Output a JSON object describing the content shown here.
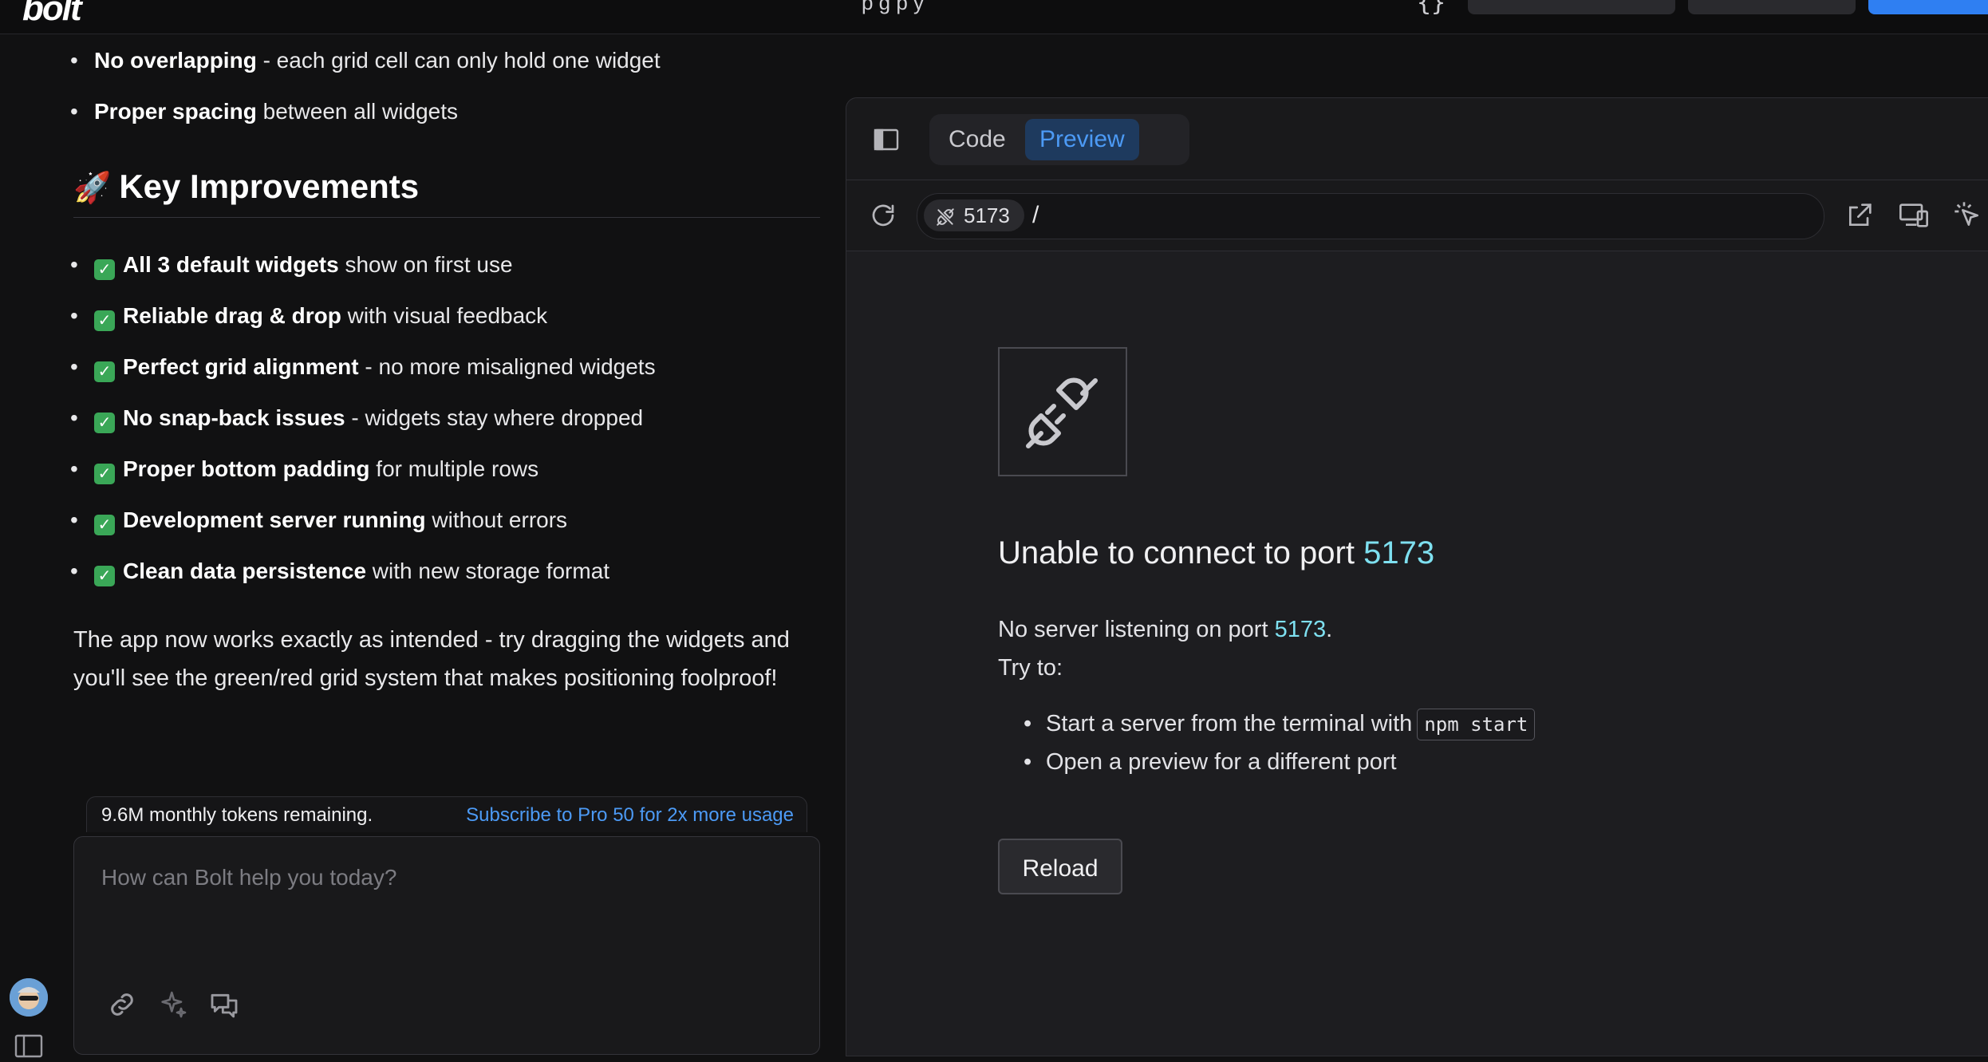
{
  "topbar": {
    "logo": "bolt",
    "title_fragment": "p  g      p   y",
    "braces": "{}"
  },
  "chat": {
    "intro_items": [
      {
        "bold": "No overlapping",
        "rest": " - each grid cell can only hold one widget"
      },
      {
        "bold": "Proper spacing",
        "rest": " between all widgets"
      }
    ],
    "heading_emoji": "🚀",
    "heading": "Key Improvements",
    "check_glyph": "✓",
    "improvements": [
      {
        "bold": "All 3 default widgets",
        "rest": " show on first use"
      },
      {
        "bold": "Reliable drag & drop",
        "rest": " with visual feedback"
      },
      {
        "bold": "Perfect grid alignment",
        "rest": " - no more misaligned widgets"
      },
      {
        "bold": "No snap-back issues",
        "rest": " - widgets stay where dropped"
      },
      {
        "bold": "Proper bottom padding",
        "rest": " for multiple rows"
      },
      {
        "bold": "Development server running",
        "rest": " without errors"
      },
      {
        "bold": "Clean data persistence",
        "rest": " with new storage format"
      }
    ],
    "summary": "The app now works exactly as intended - try dragging the widgets and you'll see the green/red grid system that makes positioning foolproof!"
  },
  "tokens": {
    "remaining": "9.6M monthly tokens remaining.",
    "upgrade_link": "Subscribe to Pro 50 for 2x more usage"
  },
  "composer": {
    "placeholder": "How can Bolt help you today?",
    "icons": [
      "link-icon",
      "sparkle-icon",
      "chat-icon"
    ]
  },
  "preview": {
    "tabs": {
      "code": "Code",
      "preview": "Preview",
      "active": "preview"
    },
    "port": "5173",
    "path": "/",
    "error_title_prefix": "Unable to connect to port ",
    "error_title_port": "5173",
    "no_server_prefix": "No server listening on port ",
    "no_server_port": "5173",
    "no_server_suffix": ".",
    "try_to": "Try to:",
    "suggestion_1": "Start a server from the terminal with",
    "command": "npm start",
    "suggestion_2": "Open a preview for a different port",
    "reload_label": "Reload"
  },
  "colors": {
    "accent_blue": "#4c9af5",
    "port_cyan": "#7ee0f0",
    "check_green": "#3aa757",
    "background": "#111112"
  }
}
